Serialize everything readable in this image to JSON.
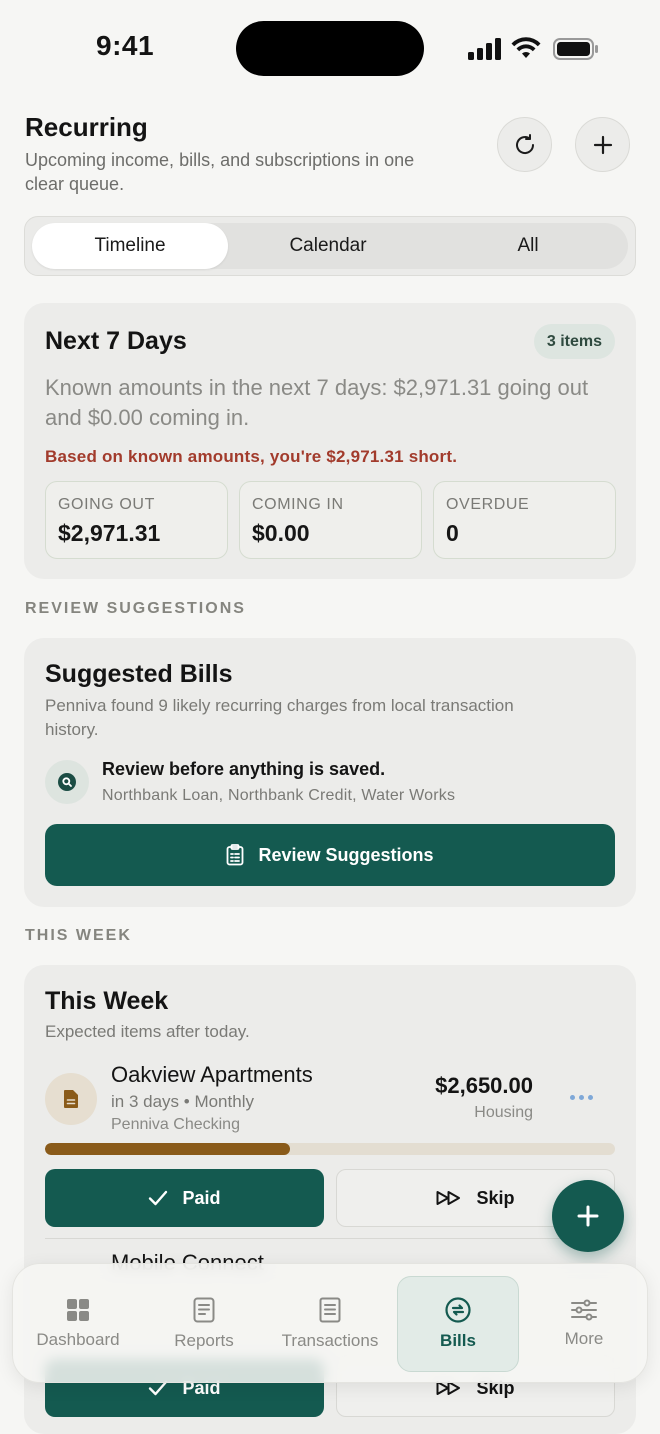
{
  "status_bar": {
    "time": "9:41",
    "icons": [
      "signal-icon",
      "wifi-icon",
      "battery-icon"
    ]
  },
  "header": {
    "title": "Recurring",
    "subtitle": "Upcoming income, bills, and subscriptions in one clear queue.",
    "buttons": [
      "refresh-icon",
      "plus-icon"
    ]
  },
  "segments": [
    {
      "label": "Timeline",
      "active": true
    },
    {
      "label": "Calendar",
      "active": false
    },
    {
      "label": "All",
      "active": false
    }
  ],
  "next7": {
    "title": "Next 7 Days",
    "badge": "3 items",
    "description": "Known amounts in the next 7 days: $2,971.31 going out and $0.00 coming in.",
    "warning": "Based on known amounts, you're $2,971.31 short.",
    "stats": [
      {
        "label": "GOING OUT",
        "value": "$2,971.31"
      },
      {
        "label": "COMING IN",
        "value": "$0.00"
      },
      {
        "label": "OVERDUE",
        "value": "0"
      }
    ]
  },
  "review_section": {
    "heading": "REVIEW SUGGESTIONS"
  },
  "suggested_bills": {
    "title": "Suggested Bills",
    "subtitle": "Penniva found 9 likely recurring charges from local transaction history.",
    "notice": "Review before anything is saved.",
    "names": "Northbank Loan, Northbank Credit, Water Works",
    "button": "Review Suggestions"
  },
  "week_section": {
    "heading": "THIS WEEK"
  },
  "this_week": {
    "title": "This Week",
    "subtitle": "Expected items after today.",
    "bill": {
      "name": "Oakview Apartments",
      "meta": "in 3 days • Monthly",
      "account": "Penniva Checking",
      "amount": "$2,650.00",
      "category": "Housing",
      "progress": 0.43
    },
    "paid_label": "Paid",
    "skip_label": "Skip",
    "next_bill_name": "Mobile Connect"
  },
  "tabbar": [
    {
      "label": "Dashboard",
      "icon": "grid-icon",
      "active": false
    },
    {
      "label": "Reports",
      "icon": "report-icon",
      "active": false
    },
    {
      "label": "Transactions",
      "icon": "list-icon",
      "active": false
    },
    {
      "label": "Bills",
      "icon": "repeat-icon",
      "active": true
    },
    {
      "label": "More",
      "icon": "sliders-icon",
      "active": false
    }
  ],
  "colors": {
    "accent": "#145a50",
    "warning": "#a23b2c",
    "progress": "#8a5b1a"
  }
}
